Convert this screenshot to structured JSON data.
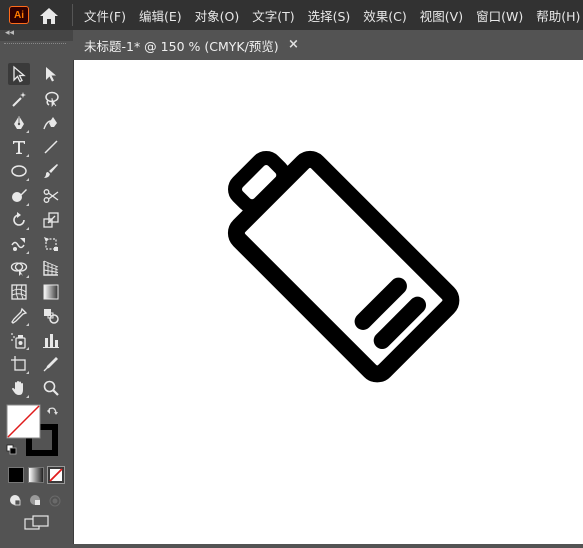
{
  "app": {
    "logo_text": "Ai"
  },
  "menu": {
    "items": [
      "文件(F)",
      "编辑(E)",
      "对象(O)",
      "文字(T)",
      "选择(S)",
      "效果(C)",
      "视图(V)",
      "窗口(W)",
      "帮助(H)"
    ]
  },
  "document": {
    "tab_title": "未标题-1* @ 150 % (CMYK/预览)",
    "close_glyph": "×"
  },
  "toolbar": {
    "collapse_glyph": "◂◂",
    "tools": [
      {
        "name": "selection-tool-icon",
        "active": true
      },
      {
        "name": "direct-selection-tool-icon"
      },
      {
        "name": "magic-wand-tool-icon"
      },
      {
        "name": "lasso-tool-icon"
      },
      {
        "name": "pen-tool-icon"
      },
      {
        "name": "curvature-tool-icon"
      },
      {
        "name": "type-tool-icon"
      },
      {
        "name": "line-segment-tool-icon"
      },
      {
        "name": "ellipse-tool-icon"
      },
      {
        "name": "paintbrush-tool-icon"
      },
      {
        "name": "shaper-tool-icon"
      },
      {
        "name": "scissors-tool-icon"
      },
      {
        "name": "rotate-tool-icon"
      },
      {
        "name": "scale-tool-icon"
      },
      {
        "name": "warp-tool-icon"
      },
      {
        "name": "free-transform-tool-icon"
      },
      {
        "name": "shape-builder-tool-icon"
      },
      {
        "name": "perspective-grid-tool-icon"
      },
      {
        "name": "mesh-tool-icon"
      },
      {
        "name": "gradient-tool-icon"
      },
      {
        "name": "eyedropper-tool-icon"
      },
      {
        "name": "blend-tool-icon"
      },
      {
        "name": "symbol-sprayer-tool-icon"
      },
      {
        "name": "column-graph-tool-icon"
      },
      {
        "name": "artboard-tool-icon"
      },
      {
        "name": "slice-tool-icon"
      },
      {
        "name": "hand-tool-icon"
      },
      {
        "name": "zoom-tool-icon"
      }
    ],
    "fill_color": "#ffffff",
    "stroke_color": "#000000"
  },
  "colors": {
    "menubar": "#323232",
    "panel": "#535353",
    "canvas": "#ffffff",
    "accent_logo": "#ff7c00"
  }
}
